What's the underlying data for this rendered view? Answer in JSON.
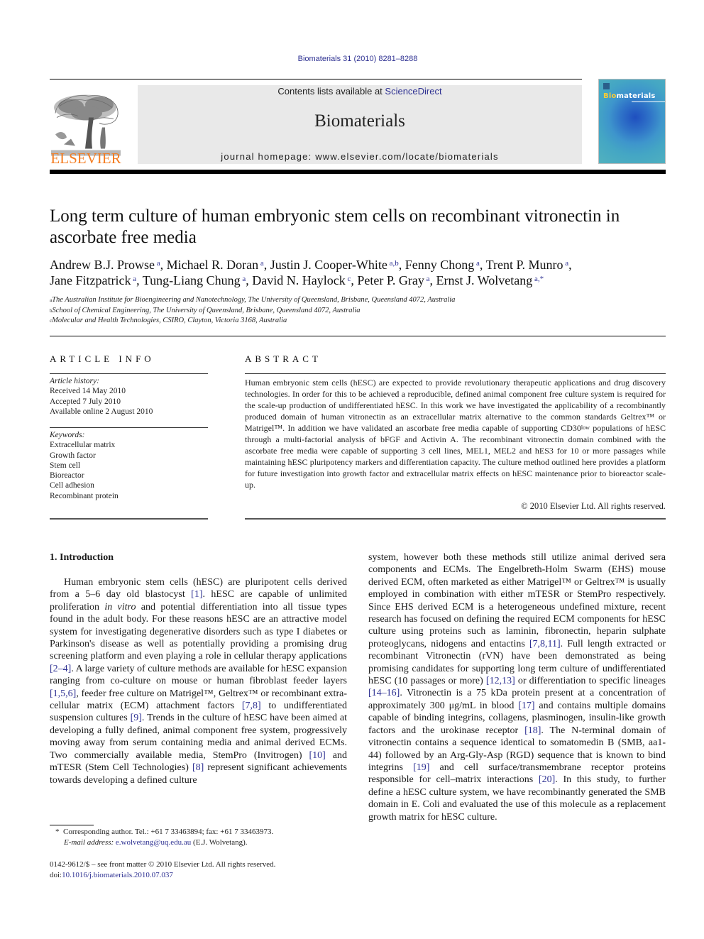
{
  "header": {
    "journal_ref": "Biomaterials 31 (2010) 8281–8288",
    "contents_prefix": "Contents lists available at ",
    "contents_link": "ScienceDirect",
    "journal_title": "Biomaterials",
    "homepage": "journal homepage: www.elsevier.com/locate/biomaterials",
    "publisher_logo_text": "ELSEVIER",
    "cover": {
      "title_accent": "Bio",
      "title_rest": "materials"
    },
    "colors": {
      "link": "#2e3192",
      "elsevier_orange": "#f47c20",
      "masthead_bg": "#e9e9e9"
    }
  },
  "article": {
    "title": "Long term culture of human embryonic stem cells on recombinant vitronectin in ascorbate free media",
    "authors": [
      {
        "name": "Andrew B.J. Prowse",
        "aff": "a"
      },
      {
        "name": "Michael R. Doran",
        "aff": "a"
      },
      {
        "name": "Justin J. Cooper-White",
        "aff": "a,b"
      },
      {
        "name": "Fenny Chong",
        "aff": "a"
      },
      {
        "name": "Trent P. Munro",
        "aff": "a"
      },
      {
        "name": "Jane Fitzpatrick",
        "aff": "a"
      },
      {
        "name": "Tung-Liang Chung",
        "aff": "a"
      },
      {
        "name": "David N. Haylock",
        "aff": "c"
      },
      {
        "name": "Peter P. Gray",
        "aff": "a"
      },
      {
        "name": "Ernst J. Wolvetang",
        "aff": "a,*"
      }
    ],
    "affiliations": [
      {
        "key": "a",
        "text": "The Australian Institute for Bioengineering and Nanotechnology, The University of Queensland, Brisbane, Queensland 4072, Australia"
      },
      {
        "key": "b",
        "text": "School of Chemical Engineering, The University of Queensland, Brisbane, Queensland 4072, Australia"
      },
      {
        "key": "c",
        "text": "Molecular and Health Technologies, CSIRO, Clayton, Victoria 3168, Australia"
      }
    ]
  },
  "article_info": {
    "heading": "ARTICLE INFO",
    "history_label": "Article history:",
    "history": [
      "Received 14 May 2010",
      "Accepted 7 July 2010",
      "Available online 2 August 2010"
    ],
    "keywords_label": "Keywords:",
    "keywords": [
      "Extracellular matrix",
      "Growth factor",
      "Stem cell",
      "Bioreactor",
      "Cell adhesion",
      "Recombinant protein"
    ]
  },
  "abstract": {
    "heading": "ABSTRACT",
    "text_before_sup": "Human embryonic stem cells (hESC) are expected to provide revolutionary therapeutic applications and drug discovery technologies. In order for this to be achieved a reproducible, defined animal component free culture system is required for the scale-up production of undifferentiated hESC. In this work we have investigated the applicability of a recombinantly produced domain of human vitronectin as an extracellular matrix alternative to the common standards Geltrex™ or Matrigel™. In addition we have validated an ascorbate free media capable of supporting CD30",
    "sup": "low",
    "text_after_sup": " populations of hESC through a multi-factorial analysis of bFGF and Activin A. The recombinant vitronectin domain combined with the ascorbate free media were capable of supporting 3 cell lines, MEL1, MEL2 and hES3 for 10 or more passages while maintaining hESC pluripotency markers and differentiation capacity. The culture method outlined here provides a platform for future investigation into growth factor and extracellular matrix effects on hESC maintenance prior to bioreactor scale-up.",
    "copyright": "© 2010 Elsevier Ltd. All rights reserved."
  },
  "introduction": {
    "heading": "1.  Introduction",
    "left_column": [
      {
        "t": "Human embryonic stem cells (hESC) are pluripotent cells derived from a 5–6 day old blastocyst "
      },
      {
        "ref": "[1]"
      },
      {
        "t": ". hESC are capable of unlimited proliferation "
      },
      {
        "i": "in vitro"
      },
      {
        "t": " and potential differentiation into all tissue types found in the adult body. For these reasons hESC are an attractive model system for investigating degenerative disorders such as type I diabetes or Parkinson's disease as well as potentially providing a promising drug screening platform and even playing a role in cellular therapy applications "
      },
      {
        "ref": "[2–4]"
      },
      {
        "t": ". A large variety of culture methods are available for hESC expansion ranging from co-culture on mouse or human fibroblast feeder layers "
      },
      {
        "ref": "[1,5,6]"
      },
      {
        "t": ", feeder free culture on Matrigel™, Geltrex™ or recombinant extra-cellular matrix (ECM) attachment factors "
      },
      {
        "ref": "[7,8]"
      },
      {
        "t": " to undifferentiated suspension cultures "
      },
      {
        "ref": "[9]"
      },
      {
        "t": ". Trends in the culture of hESC have been aimed at developing a fully defined, animal component free system, progressively moving away from serum containing media and animal derived ECMs. Two commercially available media, StemPro (Invitrogen) "
      },
      {
        "ref": "[10]"
      },
      {
        "t": " and mTESR (Stem Cell Technologies) "
      },
      {
        "ref": "[8]"
      },
      {
        "t": " represent significant achievements towards developing a defined culture"
      }
    ],
    "right_column": [
      {
        "t": "system, however both these methods still utilize animal derived sera components and ECMs. The Engelbreth-Holm Swarm (EHS) mouse derived ECM, often marketed as either Matrigel™ or Geltrex™ is usually employed in combination with either mTESR or StemPro respectively. Since EHS derived ECM is a heterogeneous undefined mixture, recent research has focused on defining the required ECM components for hESC culture using proteins such as laminin, fibronectin, heparin sulphate proteoglycans, nidogens and entactins "
      },
      {
        "ref": "[7,8,11]"
      },
      {
        "t": ". Full length extracted or recombinant Vitronectin (rVN) have been demonstrated as being promising candidates for supporting long term culture of undifferentiated hESC (10 passages or more) "
      },
      {
        "ref": "[12,13]"
      },
      {
        "t": " or differentiation to specific lineages "
      },
      {
        "ref": "[14–16]"
      },
      {
        "t": ". Vitronectin is a 75 kDa protein present at a concentration of approximately 300 μg/mL in blood "
      },
      {
        "ref": "[17]"
      },
      {
        "t": " and contains multiple domains capable of binding integrins, collagens, plasminogen, insulin-like growth factors and the urokinase receptor "
      },
      {
        "ref": "[18]"
      },
      {
        "t": ". The N-terminal domain of vitronectin contains a sequence identical to somatomedin B (SMB, aa1-44) followed by an Arg-Gly-Asp (RGD) sequence that is known to bind integrins "
      },
      {
        "ref": "[19]"
      },
      {
        "t": " and cell surface/transmembrane receptor proteins responsible for cell–matrix interactions "
      },
      {
        "ref": "[20]"
      },
      {
        "t": ". In this study, to further define a hESC culture system, we have recombinantly generated the SMB domain in E. Coli and evaluated the use of this molecule as a replacement growth matrix for hESC culture."
      }
    ]
  },
  "footnote": {
    "star": "*",
    "corresponding": "Corresponding author. Tel.: +61 7 33463894; fax: +61 7 33463973.",
    "email_label": "E-mail address:",
    "email": "e.wolvetang@uq.edu.au",
    "email_suffix": " (E.J. Wolvetang)."
  },
  "front_matter": {
    "issn_line": "0142-9612/$ – see front matter © 2010 Elsevier Ltd. All rights reserved.",
    "doi_label": "doi:",
    "doi": "10.1016/j.biomaterials.2010.07.037"
  }
}
